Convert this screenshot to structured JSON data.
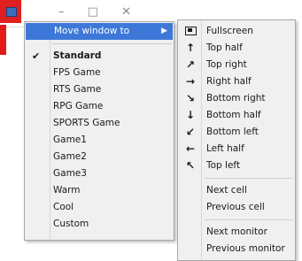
{
  "main_menu": {
    "move_window_to": "Move window to",
    "items": [
      {
        "label": "Standard",
        "checked": true,
        "bold": true
      },
      {
        "label": "FPS Game"
      },
      {
        "label": "RTS Game"
      },
      {
        "label": "RPG Game"
      },
      {
        "label": "SPORTS Game"
      },
      {
        "label": "Game1"
      },
      {
        "label": "Game2"
      },
      {
        "label": "Game3"
      },
      {
        "label": "Warm"
      },
      {
        "label": "Cool"
      },
      {
        "label": "Custom"
      }
    ],
    "check_glyph": "✔",
    "arrow_glyph": "▶"
  },
  "sub_menu": {
    "positions": [
      {
        "label": "Fullscreen",
        "icon": "fullscreen-icon",
        "glyph": ""
      },
      {
        "label": "Top half",
        "icon": "arrow-up-icon",
        "glyph": "↑"
      },
      {
        "label": "Top right",
        "icon": "arrow-up-right-icon",
        "glyph": "↗"
      },
      {
        "label": "Right half",
        "icon": "arrow-right-icon",
        "glyph": "→"
      },
      {
        "label": "Bottom right",
        "icon": "arrow-down-right-icon",
        "glyph": "↘"
      },
      {
        "label": "Bottom half",
        "icon": "arrow-down-icon",
        "glyph": "↓"
      },
      {
        "label": "Bottom left",
        "icon": "arrow-down-left-icon",
        "glyph": "↙"
      },
      {
        "label": "Left half",
        "icon": "arrow-left-icon",
        "glyph": "←"
      },
      {
        "label": "Top left",
        "icon": "arrow-up-left-icon",
        "glyph": "↖"
      }
    ],
    "cells": [
      {
        "label": "Next cell"
      },
      {
        "label": "Previous cell"
      }
    ],
    "monitors": [
      {
        "label": "Next monitor"
      },
      {
        "label": "Previous monitor"
      }
    ]
  },
  "window_caption_glyphs": {
    "minimize": "–",
    "maximize": "□",
    "close": "✕"
  },
  "colors": {
    "highlight": "#3d78d8",
    "menu_bg": "#f0f0f0",
    "window_icon": "#e02020"
  }
}
